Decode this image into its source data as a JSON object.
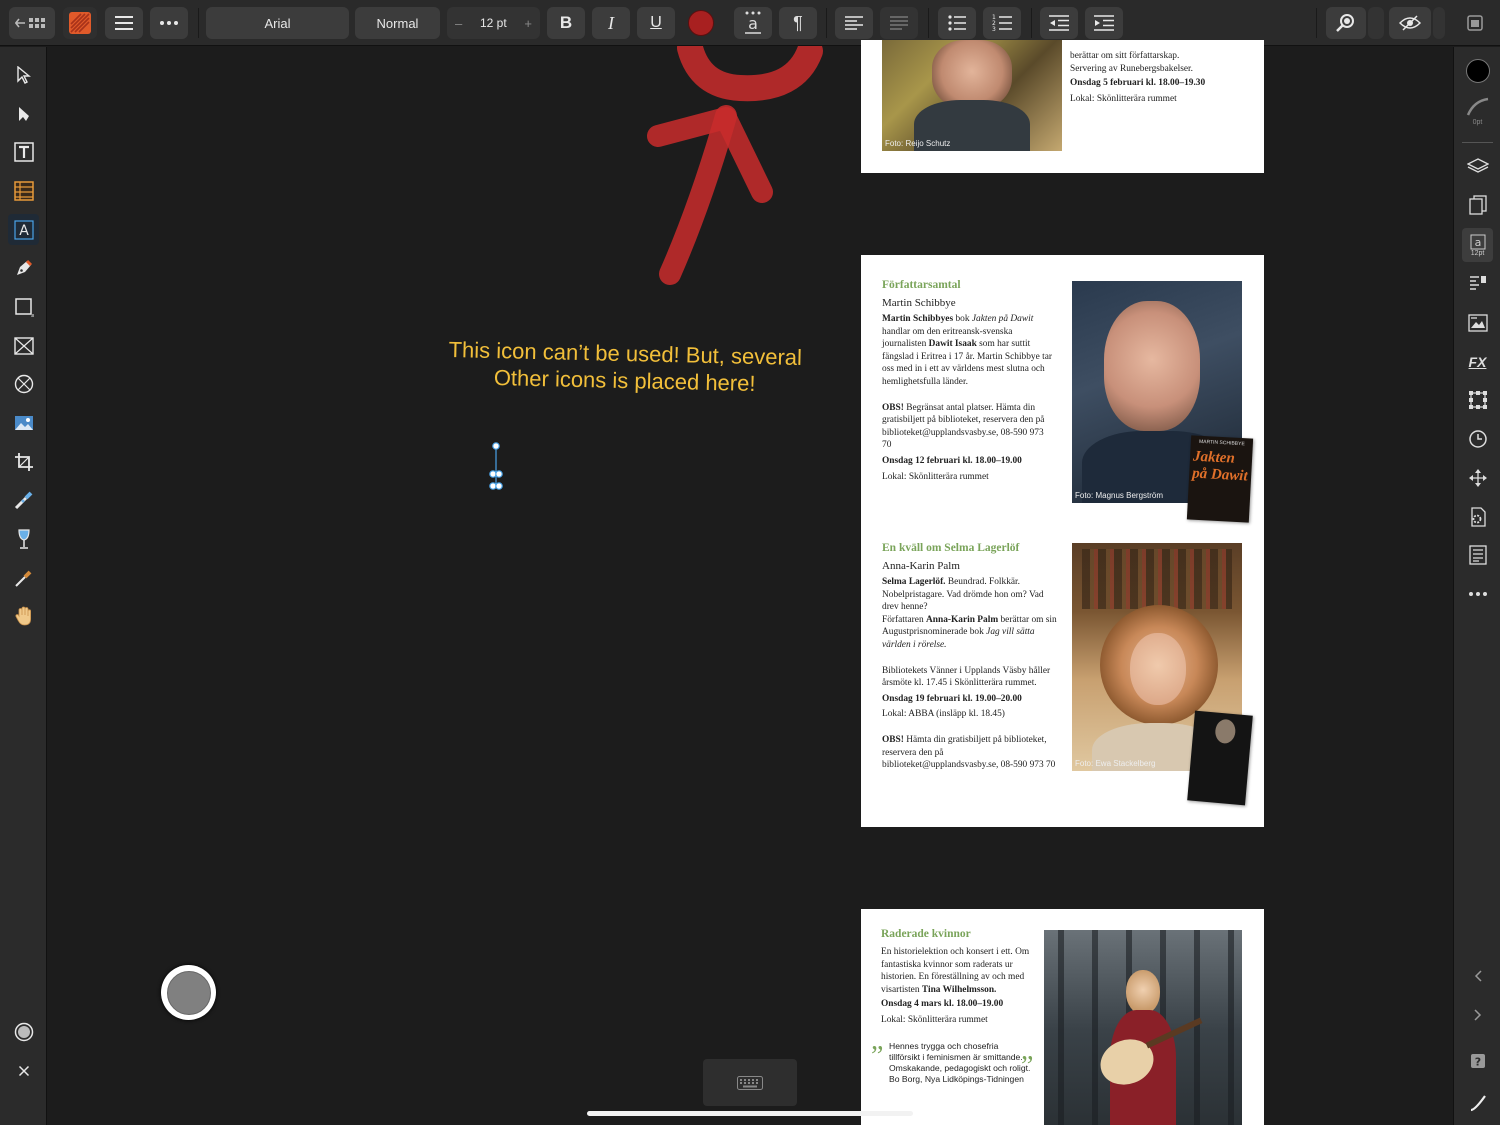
{
  "toolbar": {
    "font_name": "Arial",
    "font_style": "Normal",
    "font_size": "12 pt",
    "size_minus": "–",
    "size_plus": "+",
    "bold": "B",
    "italic": "I",
    "underline": "U",
    "text_color": "#a82020"
  },
  "annotation": {
    "line1": "This icon can’t be used! But, several",
    "line2": "Other icons is placed here!"
  },
  "right_panel": {
    "stroke_width": "0pt",
    "text_size": "12pt"
  },
  "page1": {
    "text1": "berättar om sitt författarskap.",
    "text2": "Servering av Runebergsbakelser.",
    "date": "Onsdag 5 februari kl. 18.00–19.30",
    "venue": "Lokal: Skönlitterära rummet",
    "caption": "Foto: Reijo Schutz"
  },
  "page2": {
    "event1": {
      "heading": "Författarsamtal",
      "name": "Martin Schibbye",
      "desc_a": "Martin Schibbyes",
      "desc_b": " bok ",
      "desc_c": "Jakten på Dawit",
      "desc_d": " handlar om den eritreansk-svenska journalisten ",
      "desc_e": "Dawit Isaak",
      "desc_f": " som har suttit fängslad i Eritrea i 17 år. Martin Schibbye tar oss med in i ett av världens mest slutna och hemlighetsfulla länder.",
      "obs_a": "OBS!",
      "obs_b": " Begränsat antal platser. Hämta din gratisbiljett på biblioteket, reservera den på biblioteket@upplandsvasby.se, 08-590 973 70",
      "date": "Onsdag 12 februari kl. 18.00–19.00",
      "venue": "Lokal: Skönlitterära rummet",
      "caption": "Foto: Magnus Bergström",
      "book_author": "MARTIN SCHIBBYE",
      "book_title": "Jakten på Dawit"
    },
    "event2": {
      "heading": "En kväll om Selma Lagerlöf",
      "name": "Anna-Karin Palm",
      "desc_a": "Selma Lagerlöf.",
      "desc_b": " Beundrad. Folkkär. Nobelpristagare. Vad drömde hon om? Vad drev henne?",
      "desc_c": "Författaren ",
      "desc_d": "Anna-Karin Palm",
      "desc_e": " berättar om sin Augustprisnominerade bok ",
      "desc_f": "Jag vill sätta världen i rörelse.",
      "friends": "Bibliotekets Vänner i Upplands Väsby håller årsmöte kl. 17.45 i Skönlitterära rummet.",
      "date": "Onsdag 19 februari kl. 19.00–20.00",
      "venue": "Lokal: ABBA (insläpp kl. 18.45)",
      "obs_a": "OBS!",
      "obs_b": " Hämta din gratisbiljett på biblioteket, reservera den på biblioteket@upplandsvasby.se, 08-590 973 70",
      "caption": "Foto: Ewa Stackelberg"
    }
  },
  "page3": {
    "heading": "Raderade kvinnor",
    "desc_a": "En historielektion och konsert i ett. Om fantastiska kvinnor som raderats ur historien. En föreställning av och med visartisten ",
    "desc_b": "Tina Wilhelmsson.",
    "date": "Onsdag 4 mars kl. 18.00–19.00",
    "venue": "Lokal: Skönlitterära rummet",
    "quote": "Hennes trygga och chosefria tillförsikt i feminismen är smittande. Omskakande, pedagogiskt och roligt.",
    "quote_source": "Bo Borg, Nya Lidköpings-Tidningen",
    "open_quote": "„",
    "close_quote": "”"
  }
}
